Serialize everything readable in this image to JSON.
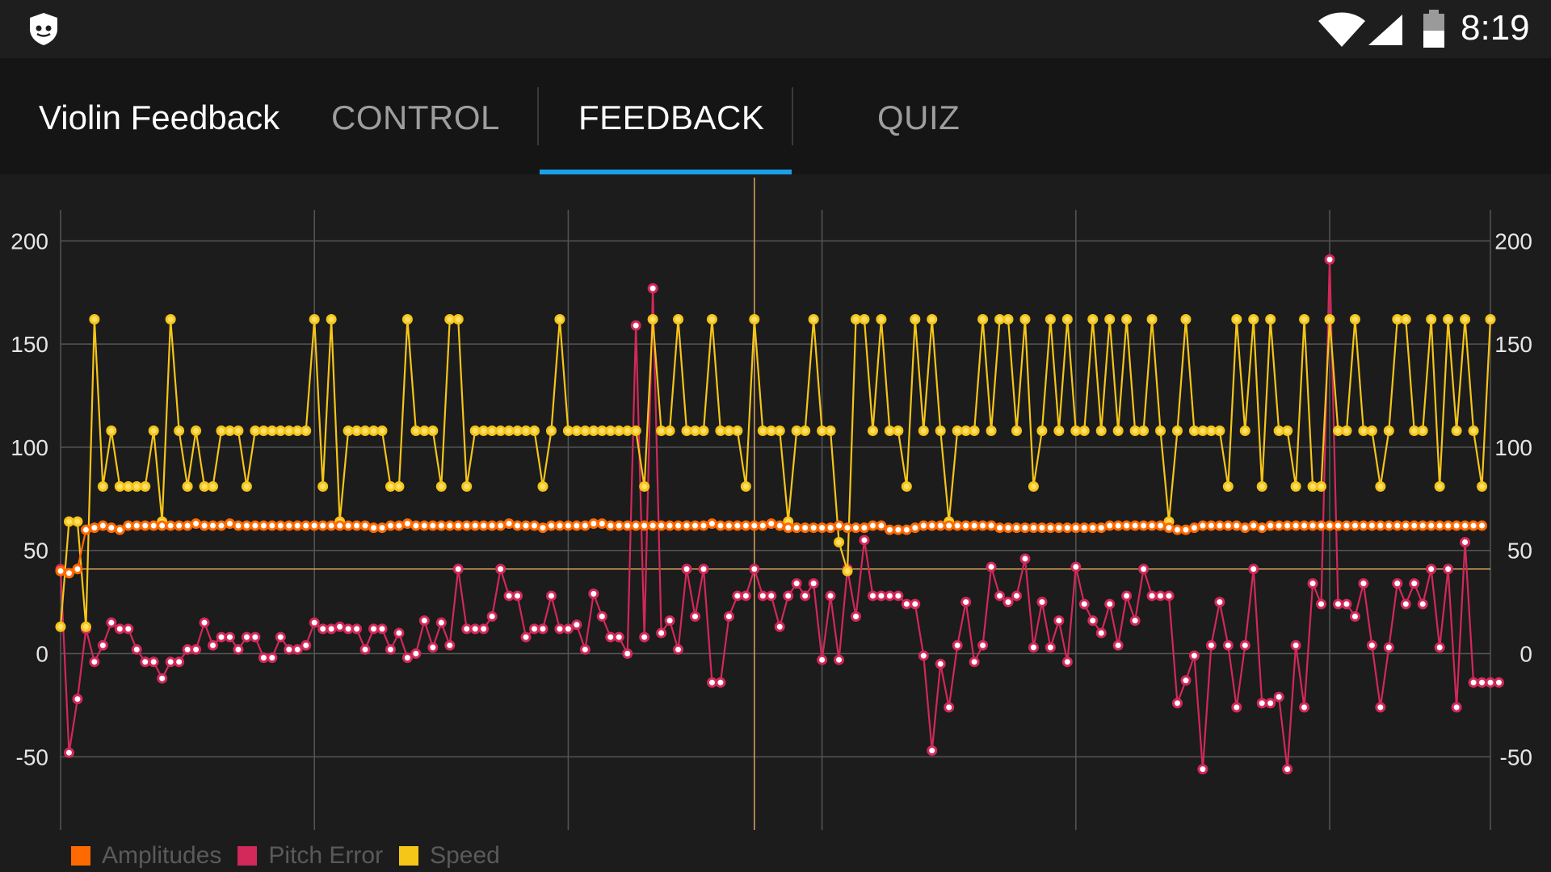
{
  "status_bar": {
    "time": "8:19",
    "icons": [
      "shield-icon",
      "wifi-icon",
      "signal-icon",
      "battery-icon"
    ]
  },
  "app_bar": {
    "title": "Violin Feedback",
    "tabs": [
      {
        "label": "CONTROL",
        "active": false
      },
      {
        "label": "FEEDBACK",
        "active": true
      },
      {
        "label": "QUIZ",
        "active": false
      }
    ],
    "accent_color": "#1aa0e6"
  },
  "chart_data": {
    "type": "line",
    "x_ticks": [
      0,
      30,
      60,
      90,
      120,
      150
    ],
    "xlim": [
      0,
      169
    ],
    "y_ticks": [
      200,
      150,
      100,
      50,
      0,
      -50
    ],
    "ylim": [
      -80,
      215
    ],
    "grid": true,
    "reference_line": {
      "x": 82,
      "y": 41,
      "color": "#d9a35c"
    },
    "legend": {
      "placement": "bottom-left"
    },
    "series": [
      {
        "name": "Amplitudes",
        "color": "#ff6a00",
        "marker_fill": "#ffffff",
        "values": [
          40,
          39,
          41,
          60,
          61,
          62,
          61,
          60,
          62,
          62,
          62,
          62,
          62,
          62,
          62,
          62,
          63,
          62,
          62,
          62,
          63,
          62,
          62,
          62,
          62,
          62,
          62,
          62,
          62,
          62,
          62,
          62,
          62,
          62,
          62,
          62,
          62,
          61,
          61,
          62,
          62,
          63,
          62,
          62,
          62,
          62,
          62,
          62,
          62,
          62,
          62,
          62,
          62,
          63,
          62,
          62,
          62,
          61,
          62,
          62,
          62,
          62,
          62,
          63,
          63,
          62,
          62,
          62,
          62,
          62,
          62,
          62,
          62,
          62,
          62,
          62,
          62,
          63,
          62,
          62,
          62,
          62,
          62,
          62,
          63,
          62,
          61,
          61,
          61,
          61,
          61,
          61,
          62,
          61,
          61,
          61,
          62,
          62,
          60,
          60,
          60,
          61,
          62,
          62,
          62,
          62,
          62,
          62,
          62,
          62,
          62,
          61,
          61,
          61,
          61,
          61,
          61,
          61,
          61,
          61,
          61,
          61,
          61,
          61,
          62,
          62,
          62,
          62,
          62,
          62,
          62,
          61,
          60,
          60,
          61,
          62,
          62,
          62,
          62,
          62,
          61,
          62,
          61,
          62,
          62,
          62,
          62,
          62,
          62,
          62,
          62,
          62,
          62,
          62,
          62,
          62,
          62,
          62,
          62,
          62,
          62,
          62,
          62,
          62,
          62,
          62,
          62,
          62,
          62
        ]
      },
      {
        "name": "Pitch Error",
        "color": "#d2285a",
        "marker_fill": "#ffffff",
        "values": [
          41,
          -48,
          -22,
          12,
          -4,
          4,
          15,
          12,
          12,
          2,
          -4,
          -4,
          -12,
          -4,
          -4,
          2,
          2,
          15,
          4,
          8,
          8,
          2,
          8,
          8,
          -2,
          -2,
          8,
          2,
          2,
          4,
          15,
          12,
          12,
          13,
          12,
          12,
          2,
          12,
          12,
          2,
          10,
          -2,
          0,
          16,
          3,
          15,
          4,
          41,
          12,
          12,
          12,
          18,
          41,
          28,
          28,
          8,
          12,
          12,
          28,
          12,
          12,
          14,
          2,
          29,
          18,
          8,
          8,
          0,
          159,
          8,
          177,
          10,
          16,
          2,
          41,
          18,
          41,
          -14,
          -14,
          18,
          28,
          28,
          41,
          28,
          28,
          13,
          28,
          34,
          28,
          34,
          -3,
          28,
          -3,
          41,
          18,
          55,
          28,
          28,
          28,
          28,
          24,
          24,
          -1,
          -47,
          -5,
          -26,
          4,
          25,
          -4,
          4,
          42,
          28,
          25,
          28,
          46,
          3,
          25,
          3,
          16,
          -4,
          42,
          24,
          16,
          10,
          24,
          4,
          28,
          16,
          41,
          28,
          28,
          28,
          -24,
          -13,
          -1,
          -56,
          4,
          25,
          4,
          -26,
          4,
          41,
          -24,
          -24,
          -21,
          -56,
          4,
          -26,
          34,
          24,
          191,
          24,
          24,
          18,
          34,
          4,
          -26,
          3,
          34,
          24,
          34,
          24,
          41,
          3,
          41,
          -26,
          54,
          -14,
          -14,
          -14,
          -14
        ]
      },
      {
        "name": "Speed",
        "color": "#f5c518",
        "marker_fill": "#ffe066",
        "values": [
          13,
          64,
          64,
          13,
          162,
          81,
          108,
          81,
          81,
          81,
          81,
          108,
          64,
          162,
          108,
          81,
          108,
          81,
          81,
          108,
          108,
          108,
          81,
          108,
          108,
          108,
          108,
          108,
          108,
          108,
          162,
          81,
          162,
          64,
          108,
          108,
          108,
          108,
          108,
          81,
          81,
          162,
          108,
          108,
          108,
          81,
          162,
          162,
          81,
          108,
          108,
          108,
          108,
          108,
          108,
          108,
          108,
          81,
          108,
          162,
          108,
          108,
          108,
          108,
          108,
          108,
          108,
          108,
          108,
          81,
          162,
          108,
          108,
          162,
          108,
          108,
          108,
          162,
          108,
          108,
          108,
          81,
          162,
          108,
          108,
          108,
          64,
          108,
          108,
          162,
          108,
          108,
          54,
          40,
          162,
          162,
          108,
          162,
          108,
          108,
          81,
          162,
          108,
          162,
          108,
          64,
          108,
          108,
          108,
          162,
          108,
          162,
          162,
          108,
          162,
          81,
          108,
          162,
          108,
          162,
          108,
          108,
          162,
          108,
          162,
          108,
          162,
          108,
          108,
          162,
          108,
          64,
          108,
          162,
          108,
          108,
          108,
          108,
          81,
          162,
          108,
          162,
          81,
          162,
          108,
          108,
          81,
          162,
          81,
          81,
          162,
          108,
          108,
          162,
          108,
          108,
          81,
          108,
          162,
          162,
          108,
          108,
          162,
          81,
          162,
          108,
          162,
          108,
          81,
          162
        ]
      }
    ]
  }
}
